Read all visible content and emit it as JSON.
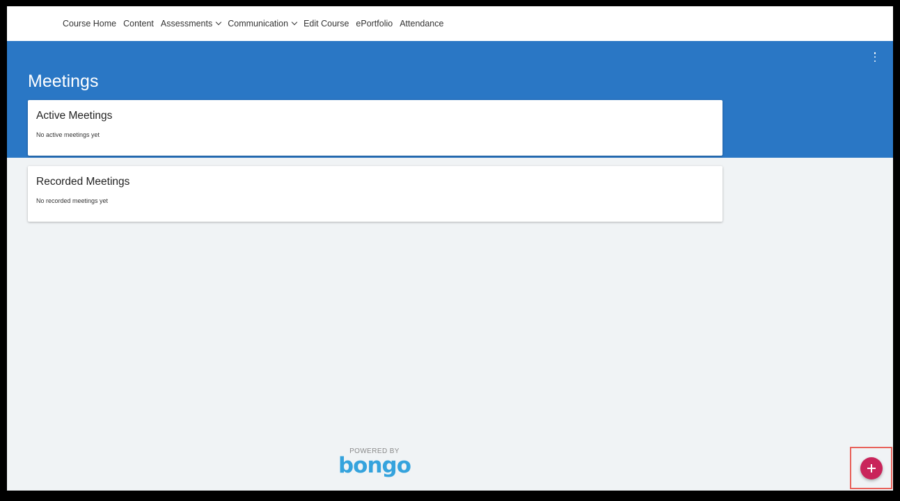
{
  "nav": {
    "items": [
      {
        "label": "Course Home",
        "has_dropdown": false
      },
      {
        "label": "Content",
        "has_dropdown": false
      },
      {
        "label": "Assessments",
        "has_dropdown": true
      },
      {
        "label": "Communication",
        "has_dropdown": true
      },
      {
        "label": "Edit Course",
        "has_dropdown": false
      },
      {
        "label": "ePortfolio",
        "has_dropdown": false
      },
      {
        "label": "Attendance",
        "has_dropdown": false
      }
    ]
  },
  "header": {
    "title": "Meetings",
    "menu_icon": "more-vertical-icon"
  },
  "sections": [
    {
      "title": "Active Meetings",
      "empty_text": "No active meetings yet"
    },
    {
      "title": "Recorded Meetings",
      "empty_text": "No recorded meetings yet"
    }
  ],
  "footer": {
    "powered_by": "POWERED BY",
    "brand": "bongo"
  },
  "fab": {
    "icon": "plus-icon"
  },
  "colors": {
    "banner": "#2a77c5",
    "fab": "#c9245a",
    "brand": "#35a3dd",
    "highlight": "#e8615a",
    "background": "#f0f3f5"
  }
}
